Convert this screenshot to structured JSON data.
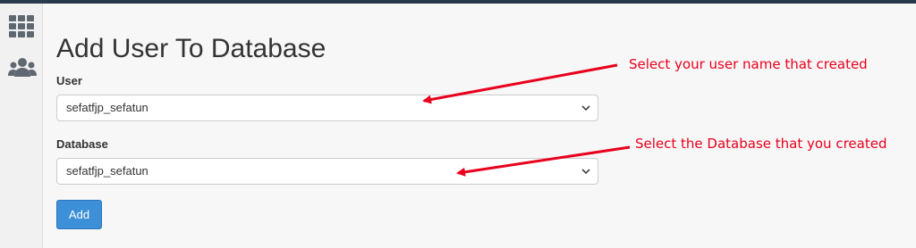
{
  "page": {
    "title": "Add User To Database"
  },
  "sidebar": {
    "items": [
      {
        "icon": "grid-icon"
      },
      {
        "icon": "users-icon"
      }
    ]
  },
  "form": {
    "user": {
      "label": "User",
      "selected": "sefatfjp_sefatun"
    },
    "database": {
      "label": "Database",
      "selected": "sefatfjp_sefatun"
    },
    "add_label": "Add"
  },
  "annotations": {
    "user_note": "Select your user name that created",
    "database_note": "Select the Database that you created"
  },
  "colors": {
    "top_bar": "#293a4a",
    "primary_button": "#3d8fd8",
    "annotation_red": "#e8001c",
    "icon_gray": "#5f6770"
  }
}
